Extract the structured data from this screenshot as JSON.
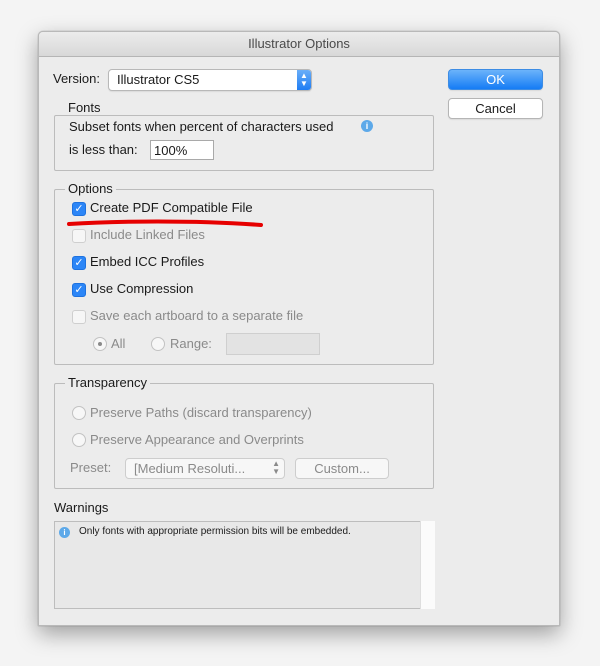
{
  "window": {
    "title": "Illustrator Options"
  },
  "version": {
    "label": "Version:",
    "selected": "Illustrator CS5"
  },
  "buttons": {
    "ok": "OK",
    "cancel": "Cancel"
  },
  "fonts": {
    "title": "Fonts",
    "line1": "Subset fonts when percent of characters used",
    "line2": "is less than:",
    "value": "100%"
  },
  "options": {
    "title": "Options",
    "items": [
      {
        "label": "Create PDF Compatible File",
        "checked": true,
        "enabled": true
      },
      {
        "label": "Include Linked Files",
        "checked": false,
        "enabled": false
      },
      {
        "label": "Embed ICC Profiles",
        "checked": true,
        "enabled": true
      },
      {
        "label": "Use Compression",
        "checked": true,
        "enabled": true
      },
      {
        "label": "Save each artboard to a separate file",
        "checked": false,
        "enabled": false
      }
    ],
    "all_label": "All",
    "range_label": "Range:",
    "range_value": ""
  },
  "transparency": {
    "title": "Transparency",
    "preserve_paths": "Preserve Paths (discard transparency)",
    "preserve_appearance": "Preserve Appearance and Overprints",
    "preset_label": "Preset:",
    "preset_value": "[Medium Resoluti...",
    "custom_label": "Custom..."
  },
  "warnings": {
    "title": "Warnings",
    "message": "Only fonts with appropriate permission bits will be embedded."
  },
  "colors": {
    "accent": "#2c86f7",
    "annotation_underline": "#e60000"
  }
}
